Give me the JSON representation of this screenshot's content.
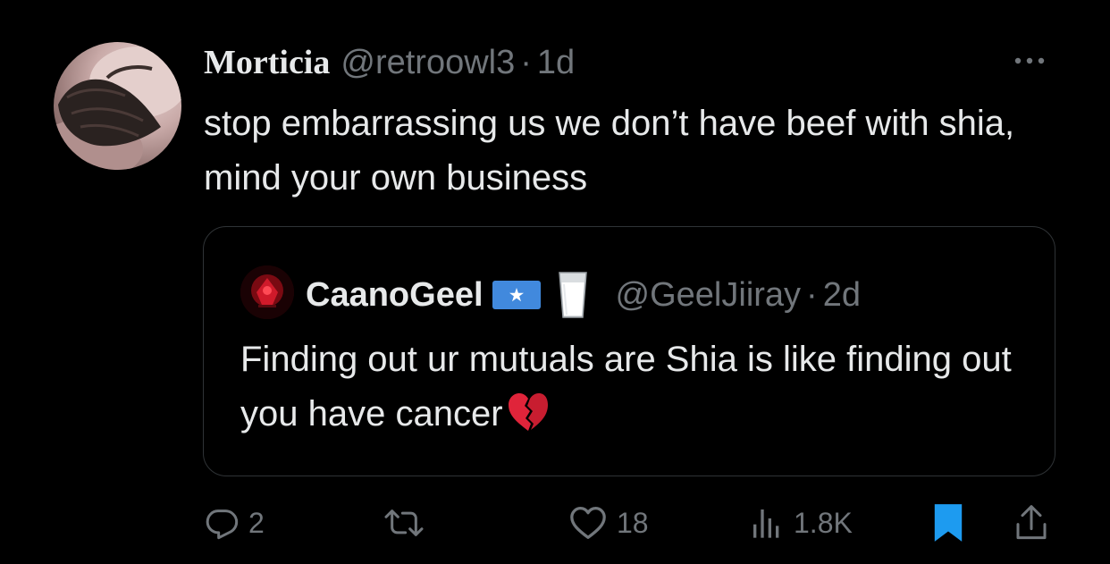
{
  "tweet": {
    "author_name": "Morticia",
    "author_handle": "@retroowl3",
    "time": "1d",
    "separator": "·",
    "text": "stop embarrassing us we don’t have beef with shia, mind your own business",
    "more_icon": "more-dots-icon"
  },
  "quote": {
    "author_name": "CaanoGeel",
    "flag_icon": "somalia-flag-icon",
    "milk_icon": "milk-glass-icon",
    "author_handle": "@GeelJiiray",
    "time": "2d",
    "separator": "·",
    "text": "Finding out ur mutuals are Shia is like finding out you have cancer",
    "emoji_icon": "broken-heart-icon"
  },
  "actions": {
    "reply_count": "2",
    "repost_count": "",
    "like_count": "18",
    "views_count": "1.8K",
    "bookmark_color": "#1d9bf0",
    "icon_color": "#71767b"
  }
}
